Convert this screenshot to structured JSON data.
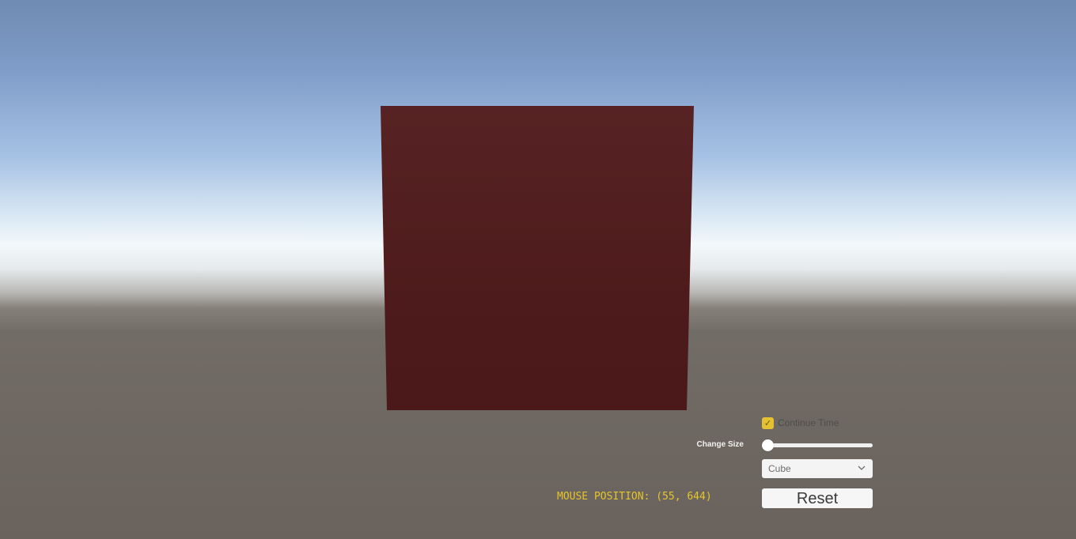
{
  "scene": {
    "object_color": "#5a2323"
  },
  "controls": {
    "continue_time": {
      "label": "Continue Time",
      "checked": true,
      "check_glyph": "✓",
      "accent": "#e3c130"
    },
    "change_size": {
      "label": "Change Size",
      "value": 0
    },
    "shape_select": {
      "selected": "Cube",
      "icon": "chevron-down-icon"
    },
    "reset": {
      "label": "Reset"
    }
  },
  "hud": {
    "mouse_position": "MOUSE POSITION: (55, 644)",
    "color": "#e6c52a"
  }
}
